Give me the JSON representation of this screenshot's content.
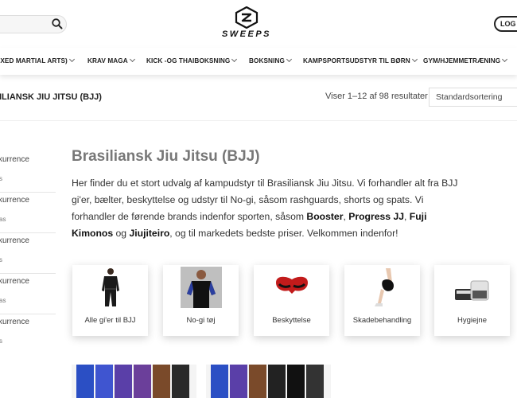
{
  "header": {
    "logo_text": "SWEEPS",
    "login_label": "LOG I"
  },
  "nav": {
    "items": [
      {
        "label": "IXED MARTIAL ARTS)"
      },
      {
        "label": "KRAV MAGA"
      },
      {
        "label": "KICK -OG THAIBOKSNING"
      },
      {
        "label": "BOKSNING"
      },
      {
        "label": "KAMPSPORTSUDSTYR TIL BØRN"
      },
      {
        "label": "GYM/HJEMMETRÆNING"
      }
    ]
  },
  "titlebar": {
    "breadcrumb": "ILIANSK JIU JITSU (BJJ)",
    "result_count": "Viser 1–12 af 98 resultater",
    "sort_value": "Standardsortering"
  },
  "sidebar": {
    "items": [
      {
        "title": "kurrence",
        "sub": "s"
      },
      {
        "title": "kurrence",
        "sub": "as"
      },
      {
        "title": "kurrence",
        "sub": "s"
      },
      {
        "title": "kurrence",
        "sub": "as"
      },
      {
        "title": "kurrence",
        "sub": "s"
      }
    ]
  },
  "main": {
    "title": "Brasiliansk Jiu Jitsu (BJJ)",
    "intro": {
      "part1": "Her finder du et stort udvalg af kampudstyr til Brasiliansk Jiu Jitsu. Vi forhandler alt fra BJJ gi'er, bælter, beskyttelse og udstyr til No-gi, såsom rashguards, shorts og spats. Vi forhandler de førende brands indenfor sporten, såsom ",
      "brand1": "Booster",
      "sep1": ", ",
      "brand2": "Progress JJ",
      "sep2": ", ",
      "brand3": "Fuji Kimonos",
      "sep3": " og ",
      "brand4": "Jiujiteiro",
      "part2": ", og til markedets bedste priser. Velkommen indenfor!"
    },
    "categories": [
      {
        "label": "Alle gi'er til BJJ",
        "icon": "gi-image"
      },
      {
        "label": "No-gi tøj",
        "icon": "rashguard-image"
      },
      {
        "label": "Beskyttelse",
        "icon": "mouthguard-image"
      },
      {
        "label": "Skadebehandling",
        "icon": "knee-brace-image"
      },
      {
        "label": "Hygiejne",
        "icon": "hygiene-products-image"
      }
    ]
  },
  "colors": {
    "title_gray": "#777777",
    "text": "#333333",
    "accent_dark": "#111111"
  }
}
